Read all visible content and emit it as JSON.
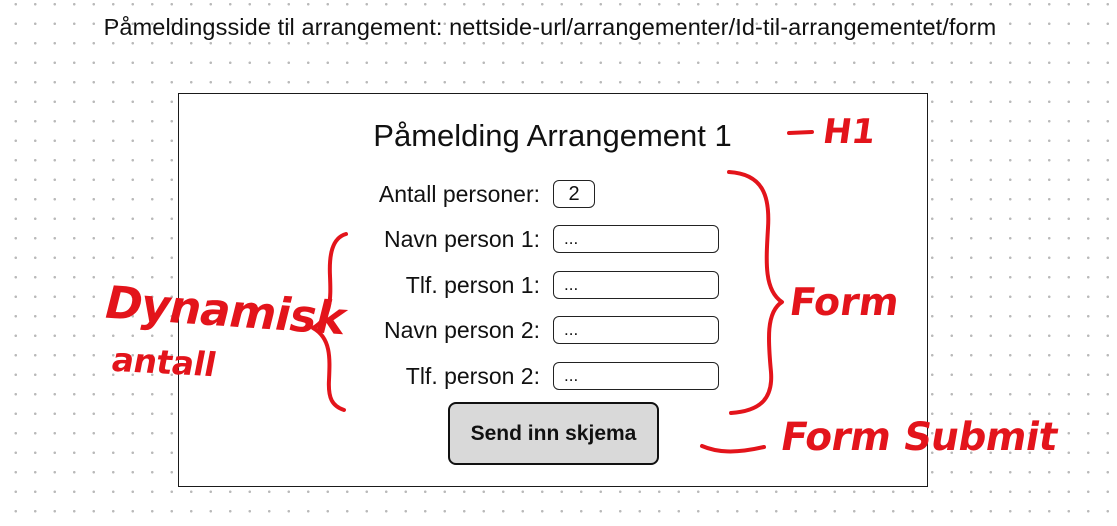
{
  "page_title": "Påmeldingsside til arrangement: nettside-url/arrangementer/Id-til-arrangementet/form",
  "form": {
    "heading": "Påmelding Arrangement 1",
    "count_label": "Antall personer:",
    "count_value": "2",
    "fields": [
      {
        "label": "Navn person 1:",
        "value": "..."
      },
      {
        "label": "Tlf. person 1:",
        "value": "..."
      },
      {
        "label": "Navn person 2:",
        "value": "..."
      },
      {
        "label": "Tlf. person 2:",
        "value": "..."
      }
    ],
    "submit_label": "Send inn skjema"
  },
  "annotations": {
    "heading": "H1",
    "dynamic_line1": "Dynamisk",
    "dynamic_line2": "antall",
    "form": "Form",
    "submit": "Form Submit"
  },
  "colors": {
    "annotation": "#e3141b",
    "button_fill": "#d9d9d9",
    "outline": "#111111"
  }
}
